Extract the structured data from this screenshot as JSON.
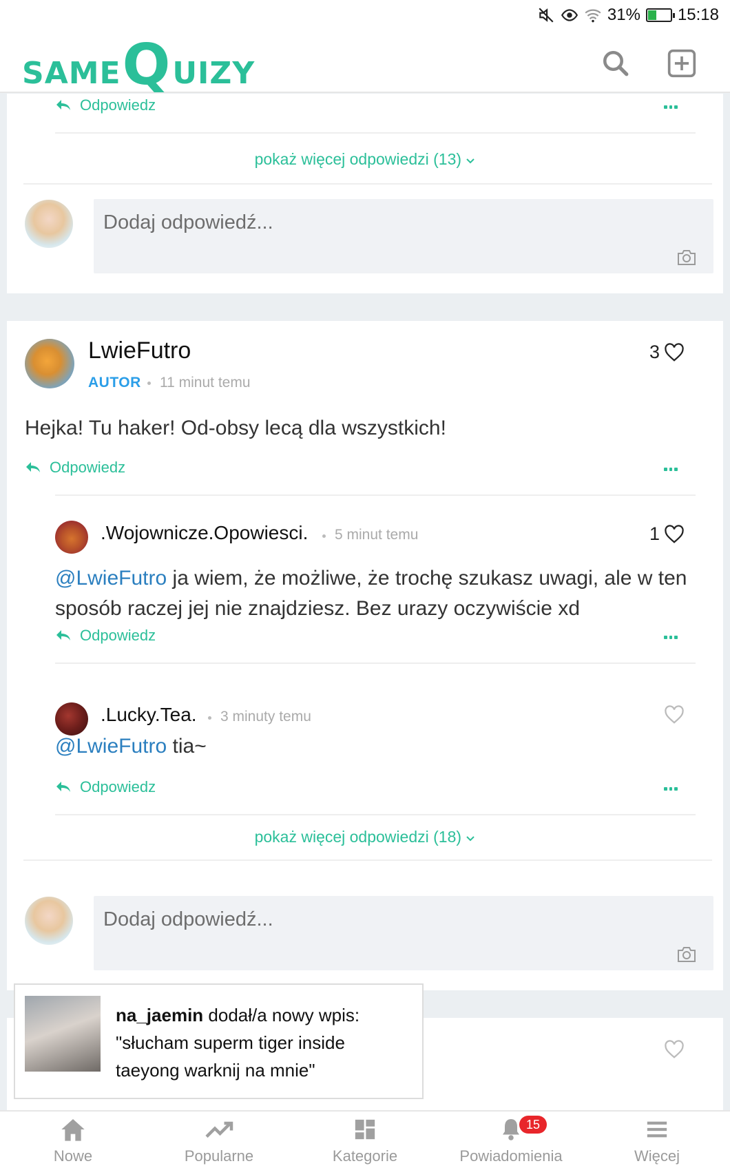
{
  "status_bar": {
    "battery": "31%",
    "time": "15:18"
  },
  "header": {
    "logo_same": "SAME",
    "logo_q": "Q",
    "logo_uizy": "UIZY"
  },
  "colors": {
    "accent": "#2bbf99",
    "mention": "#2b7fbf",
    "author_badge": "#2b9ee8",
    "badge": "#e8262b"
  },
  "top_card": {
    "reply_label": "Odpowiedz",
    "show_more": "pokaż więcej odpowiedzi (13)",
    "reply_placeholder": "Dodaj odpowiedź..."
  },
  "comment": {
    "author": "LwieFutro",
    "badge": "AUTOR",
    "time": "11 minut temu",
    "likes": "3",
    "text": "Hejka! Tu haker! Od-obsy lecą dla wszystkich!",
    "reply_label": "Odpowiedz",
    "replies": [
      {
        "author": ".Wojownicze.Opowiesci.",
        "time": "5 minut temu",
        "likes": "1",
        "mention": "@LwieFutro",
        "text": " ja wiem, że możliwe, że trochę szukasz uwagi, ale w ten sposób raczej jej nie znajdziesz. Bez urazy oczywiście xd",
        "reply_label": "Odpowiedz"
      },
      {
        "author": ".Lucky.Tea.",
        "time": "3 minuty temu",
        "likes": "",
        "mention": "@LwieFutro",
        "text": " tia~",
        "reply_label": "Odpowiedz"
      }
    ],
    "show_more": "pokaż więcej odpowiedzi (18)",
    "reply_placeholder": "Dodaj odpowiedź..."
  },
  "toast": {
    "user": "na_jaemin",
    "action": " dodał/a nowy wpis:",
    "entry": "\"słucham superm tiger inside taeyong warknij na mnie\""
  },
  "bottom_nav": [
    {
      "label": "Nowe",
      "icon": "home-icon"
    },
    {
      "label": "Popularne",
      "icon": "trending-icon"
    },
    {
      "label": "Kategorie",
      "icon": "grid-icon"
    },
    {
      "label": "Powiadomienia",
      "icon": "bell-icon",
      "badge": "15"
    },
    {
      "label": "Więcej",
      "icon": "menu-icon"
    }
  ]
}
